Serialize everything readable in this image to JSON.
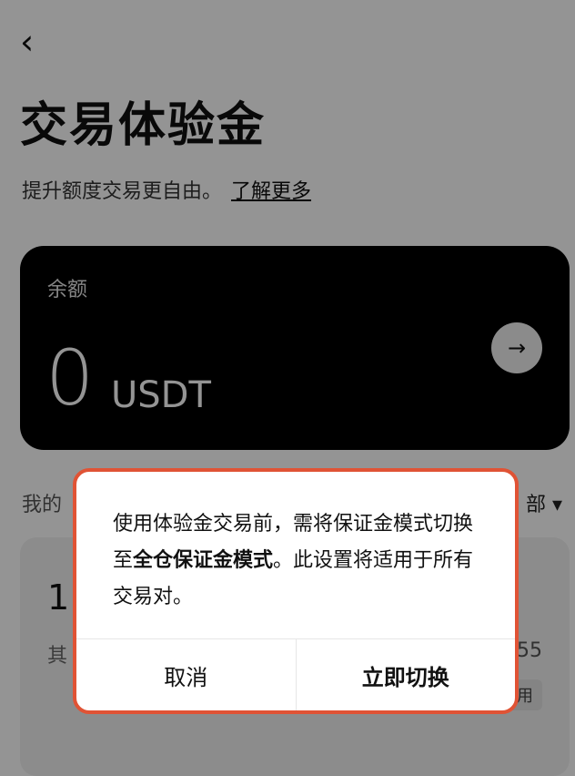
{
  "header": {
    "back_icon": "chevron-left-icon",
    "title": "交易体验金",
    "subtitle": "提升额度交易更自由。",
    "learn_more": "了解更多"
  },
  "balance": {
    "label": "余额",
    "value": "0",
    "unit": "USDT",
    "go_icon": "arrow-right-icon"
  },
  "list_header": {
    "label_partial": "我的",
    "filter_partial": "部",
    "filter_icon": "caret-down-icon"
  },
  "detail_card": {
    "amount_partial": "1",
    "note_partial": "其",
    "right_number_partial": "55",
    "tag_partial": "用"
  },
  "dialog": {
    "message_prefix": "使用体验金交易前，需将保证金模式切换至",
    "message_bold": "全仓保证金模式",
    "message_suffix": "。此设置将适用于所有交易对。",
    "cancel_label": "取消",
    "confirm_label": "立即切换",
    "highlight_color": "#e05335"
  }
}
